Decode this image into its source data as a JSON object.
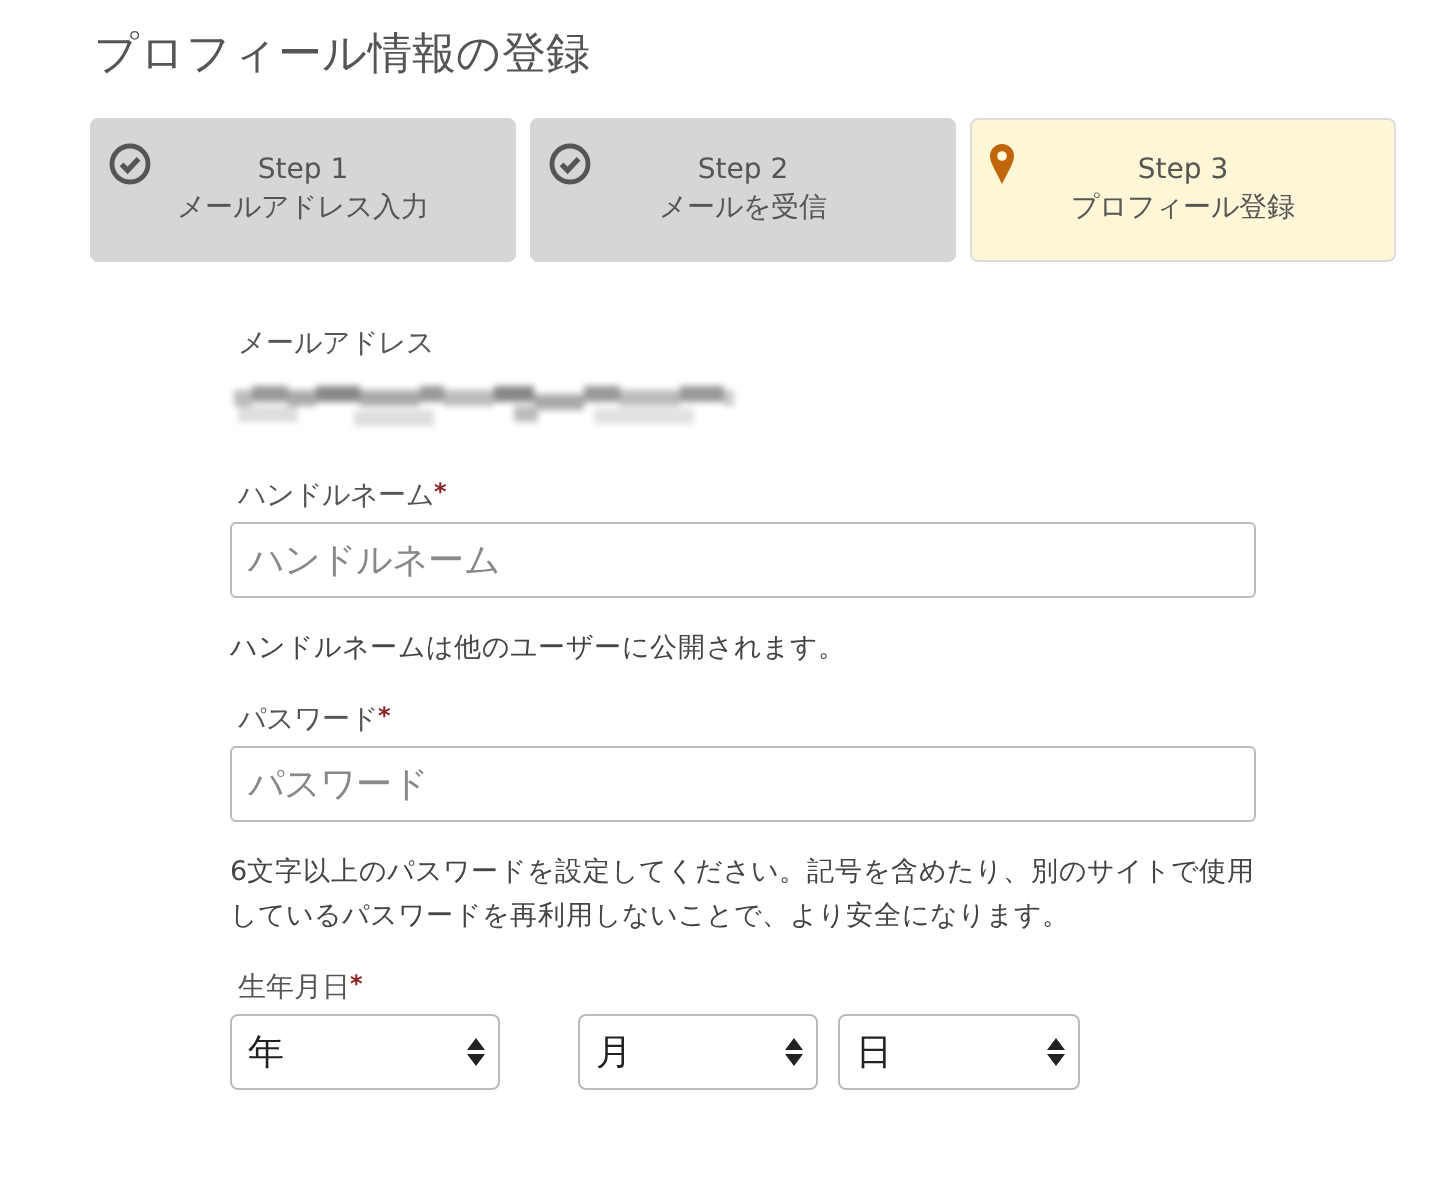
{
  "title": "プロフィール情報の登録",
  "steps": [
    {
      "kind": "done",
      "step": "Step 1",
      "label": "メールアドレス入力",
      "selected": false
    },
    {
      "kind": "done",
      "step": "Step 2",
      "label": "メールを受信",
      "selected": false
    },
    {
      "kind": "current",
      "step": "Step 3",
      "label": "プロフィール登録",
      "selected": true
    }
  ],
  "email": {
    "label": "メールアドレス"
  },
  "handle": {
    "label": "ハンドルネーム",
    "mark": "*",
    "placeholder": "ハンドルネーム",
    "help": "ハンドルネームは他のユーザーに公開されます。"
  },
  "password": {
    "label": "パスワード",
    "mark": "*",
    "placeholder": "パスワード",
    "help": "6文字以上のパスワードを設定してください。記号を含めたり、別のサイトで使用しているパスワードを再利用しないことで、より安全になります。"
  },
  "birthdate": {
    "label": "生年月日",
    "mark": "*",
    "selects": [
      {
        "value": "年"
      },
      {
        "value": "月"
      },
      {
        "value": "日"
      }
    ]
  }
}
